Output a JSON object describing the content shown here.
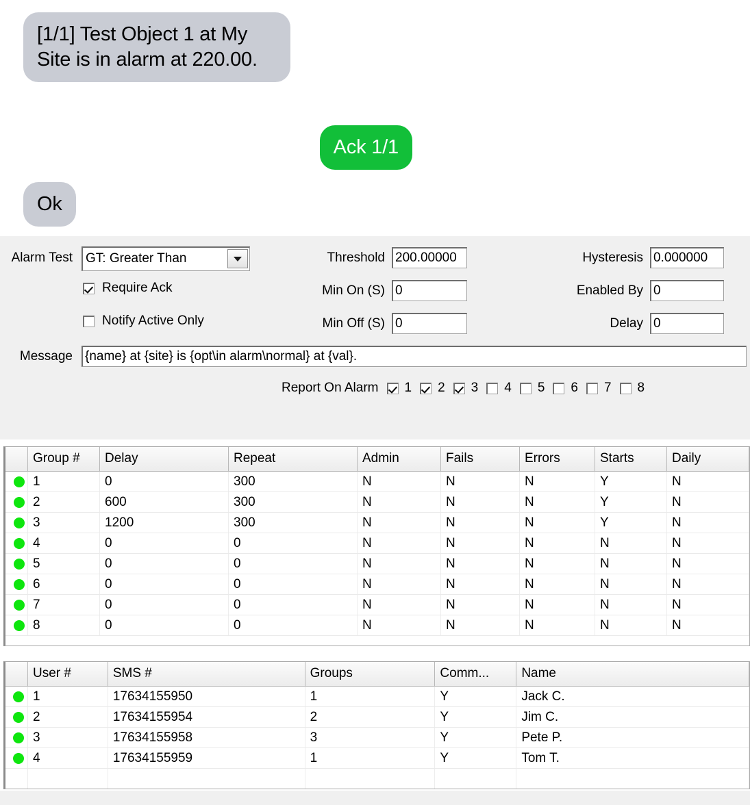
{
  "sms": {
    "messages": [
      {
        "id": "alarm-message",
        "direction": "incoming",
        "text": "[1/1] Test Object 1 at My Site is in alarm at 220.00."
      },
      {
        "id": "ack-message",
        "direction": "outgoing",
        "text": "Ack 1/1"
      },
      {
        "id": "ok-message",
        "direction": "incoming",
        "text": "Ok"
      }
    ]
  },
  "form": {
    "alarm_test": {
      "label": "Alarm Test",
      "value": "GT: Greater Than"
    },
    "require_ack": {
      "label": "Require Ack",
      "checked": true
    },
    "notify_active_only": {
      "label": "Notify Active Only",
      "checked": false
    },
    "threshold": {
      "label": "Threshold",
      "value": "200.00000"
    },
    "min_on": {
      "label": "Min On (S)",
      "value": "0"
    },
    "min_off": {
      "label": "Min Off (S)",
      "value": "0"
    },
    "hysteresis": {
      "label": "Hysteresis",
      "value": "0.000000"
    },
    "enabled_by": {
      "label": "Enabled By",
      "value": "0"
    },
    "delay": {
      "label": "Delay",
      "value": "0"
    },
    "message": {
      "label": "Message",
      "value": "{name} at {site} is {opt\\in alarm\\normal} at {val}."
    },
    "report_on_alarm": {
      "label": "Report On Alarm",
      "boxes": [
        {
          "num": "1",
          "checked": true
        },
        {
          "num": "2",
          "checked": true
        },
        {
          "num": "3",
          "checked": true
        },
        {
          "num": "4",
          "checked": false
        },
        {
          "num": "5",
          "checked": false
        },
        {
          "num": "6",
          "checked": false
        },
        {
          "num": "7",
          "checked": false
        },
        {
          "num": "8",
          "checked": false
        }
      ]
    }
  },
  "groups_table": {
    "columns": [
      "Group #",
      "Delay",
      "Repeat",
      "Admin",
      "Fails",
      "Errors",
      "Starts",
      "Daily"
    ],
    "rows": [
      {
        "status": "green",
        "cells": [
          "1",
          "0",
          "300",
          "N",
          "N",
          "N",
          "Y",
          "N"
        ]
      },
      {
        "status": "green",
        "cells": [
          "2",
          "600",
          "300",
          "N",
          "N",
          "N",
          "Y",
          "N"
        ]
      },
      {
        "status": "green",
        "cells": [
          "3",
          "1200",
          "300",
          "N",
          "N",
          "N",
          "Y",
          "N"
        ]
      },
      {
        "status": "green",
        "cells": [
          "4",
          "0",
          "0",
          "N",
          "N",
          "N",
          "N",
          "N"
        ]
      },
      {
        "status": "green",
        "cells": [
          "5",
          "0",
          "0",
          "N",
          "N",
          "N",
          "N",
          "N"
        ]
      },
      {
        "status": "green",
        "cells": [
          "6",
          "0",
          "0",
          "N",
          "N",
          "N",
          "N",
          "N"
        ]
      },
      {
        "status": "green",
        "cells": [
          "7",
          "0",
          "0",
          "N",
          "N",
          "N",
          "N",
          "N"
        ]
      },
      {
        "status": "green",
        "cells": [
          "8",
          "0",
          "0",
          "N",
          "N",
          "N",
          "N",
          "N"
        ]
      }
    ]
  },
  "users_table": {
    "columns": [
      "User #",
      "SMS #",
      "Groups",
      "Comm...",
      "Name"
    ],
    "rows": [
      {
        "status": "green",
        "cells": [
          "1",
          "17634155950",
          "1",
          "Y",
          "Jack C."
        ]
      },
      {
        "status": "green",
        "cells": [
          "2",
          "17634155954",
          "2",
          "Y",
          "Jim C."
        ]
      },
      {
        "status": "green",
        "cells": [
          "3",
          "17634155958",
          "3",
          "Y",
          "Pete P."
        ]
      },
      {
        "status": "green",
        "cells": [
          "4",
          "17634155959",
          "1",
          "Y",
          "Tom T."
        ]
      },
      {
        "status": "none",
        "cells": [
          "",
          "",
          "",
          "",
          ""
        ]
      }
    ]
  },
  "colors": {
    "incoming_bubble": "#c9ccd4",
    "outgoing_bubble": "#12bf39",
    "status_green": "#0ee60e",
    "panel_background": "#f0f0f0"
  }
}
